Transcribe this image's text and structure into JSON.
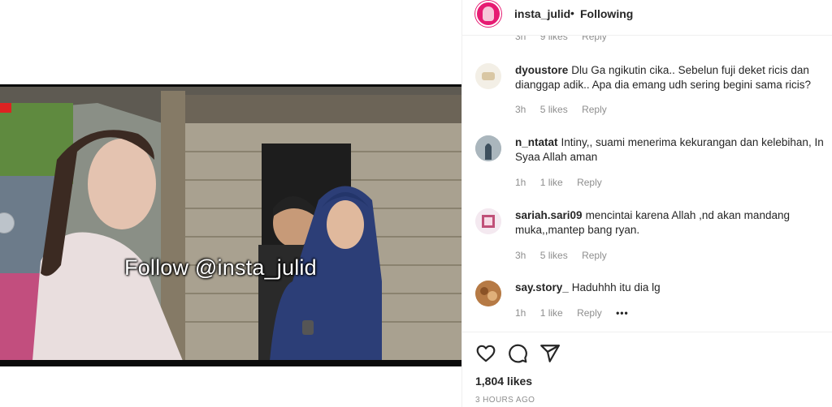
{
  "post": {
    "watermark_text": "Follow @insta_julid",
    "likes": "1,804 likes",
    "time_ago": "3 HOURS AGO"
  },
  "header": {
    "username": "insta_julid",
    "separator": "•",
    "follow_status": "Following"
  },
  "partial_comment_meta": {
    "time": "3h",
    "likes": "9 likes",
    "reply": "Reply"
  },
  "comments": [
    {
      "user": "dyoustore",
      "text": "Dlu Ga ngikutin cika.. Sebelun fuji deket ricis dan dianggap adik.. Apa dia emang udh sering begini sama ricis?",
      "time": "3h",
      "likes": "5 likes",
      "reply": "Reply"
    },
    {
      "user": "n_ntatat",
      "text": "Intiny,, suami menerima kekurangan dan kelebihan, In Syaa Allah aman",
      "time": "1h",
      "likes": "1 like",
      "reply": "Reply"
    },
    {
      "user": "sariah.sari09",
      "text": "mencintai karena Allah ,nd akan mandang muka,,mantep bang ryan.",
      "time": "3h",
      "likes": "5 likes",
      "reply": "Reply"
    },
    {
      "user": "say.story_",
      "text": "Haduhhh itu dia lg",
      "time": "1h",
      "likes": "1 like",
      "reply": "Reply",
      "more": "•••"
    }
  ],
  "icons": {
    "like": "heart-icon",
    "comment": "comment-icon",
    "share": "share-icon",
    "more": "more-options-icon"
  },
  "colors": {
    "brand_avatar": "#e61b72",
    "text": "#262626",
    "meta": "#8e8e8e",
    "divider": "#efefef"
  }
}
